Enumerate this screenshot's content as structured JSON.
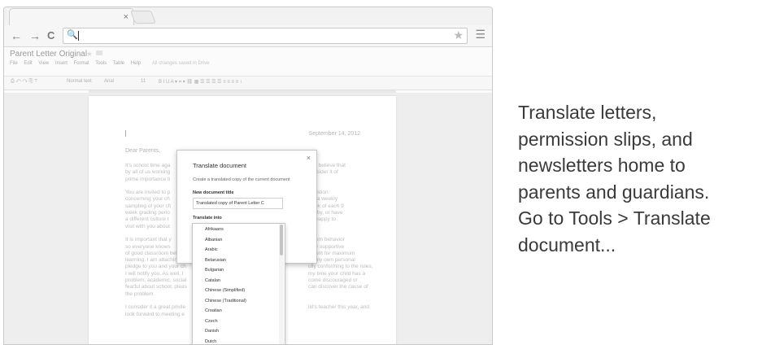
{
  "browser": {
    "tab_close": "×",
    "nav": {
      "back": "←",
      "forward": "→",
      "reload": "C"
    },
    "omnibox_search_icon": "🔍",
    "bookmark_star": "★",
    "menu_icon": "☰"
  },
  "docs": {
    "title": "Parent Letter Original",
    "menu": [
      "File",
      "Edit",
      "View",
      "Insert",
      "Format",
      "Tools",
      "Table",
      "Help"
    ],
    "saved_status": "All changes saved in Drive",
    "format_bar": {
      "style": "Normal text",
      "font": "Arial",
      "size": "11"
    }
  },
  "letter": {
    "date": "September 14, 2012",
    "greeting": "Dear Parents,",
    "paragraphs_left": [
      "It's school time aga",
      "by all of us working",
      "prime importance ti",
      "",
      "You are invited to p",
      "concerning your ch",
      "sampling of your ch",
      "week grading perio",
      "a different culture t",
      "visit with you about",
      "",
      "It is important that y",
      "so everyone knows",
      "of good classroom behavio",
      "learning. I am attaching a",
      "pledge to you and your ch",
      "I will notify you. As well, I",
      "problem, academic, social",
      "fearful about school, pleas",
      "the problem.",
      "",
      "I consider it a great privile",
      "look forward to meeting e"
    ],
    "paragraphs_right": [
      "m. I believe that",
      "consider it of",
      "",
      "",
      "question",
      "me a weekly",
      "week of each 9",
      "hobby, or have",
      "be happy to",
      "",
      "",
      "sroom behavior",
      "very supportive",
      "nment for maximum",
      "as my own personal",
      "ully conforming to the rules,",
      "my time your child has a",
      "come discouraged or",
      "can discover the cause of",
      "",
      "",
      "ild's teacher this year, and",
      ""
    ]
  },
  "dialog": {
    "title": "Translate document",
    "close": "×",
    "subtitle": "Create a translated copy of the current document",
    "new_title_label": "New document title",
    "new_title_value": "Translated copy of Parent Letter C",
    "translate_into_label": "Translate into",
    "languages": [
      "Afrikaans",
      "Albanian",
      "Arabic",
      "Belarusian",
      "Bulgarian",
      "Catalan",
      "Chinese (Simplified)",
      "Chinese (Traditional)",
      "Croatian",
      "Czech",
      "Danish",
      "Dutch"
    ]
  },
  "caption": {
    "lines": [
      "Translate letters,",
      "permission slips, and",
      "newsletters home to",
      "parents and guardians.",
      "Go to Tools > Translate",
      "document..."
    ]
  }
}
